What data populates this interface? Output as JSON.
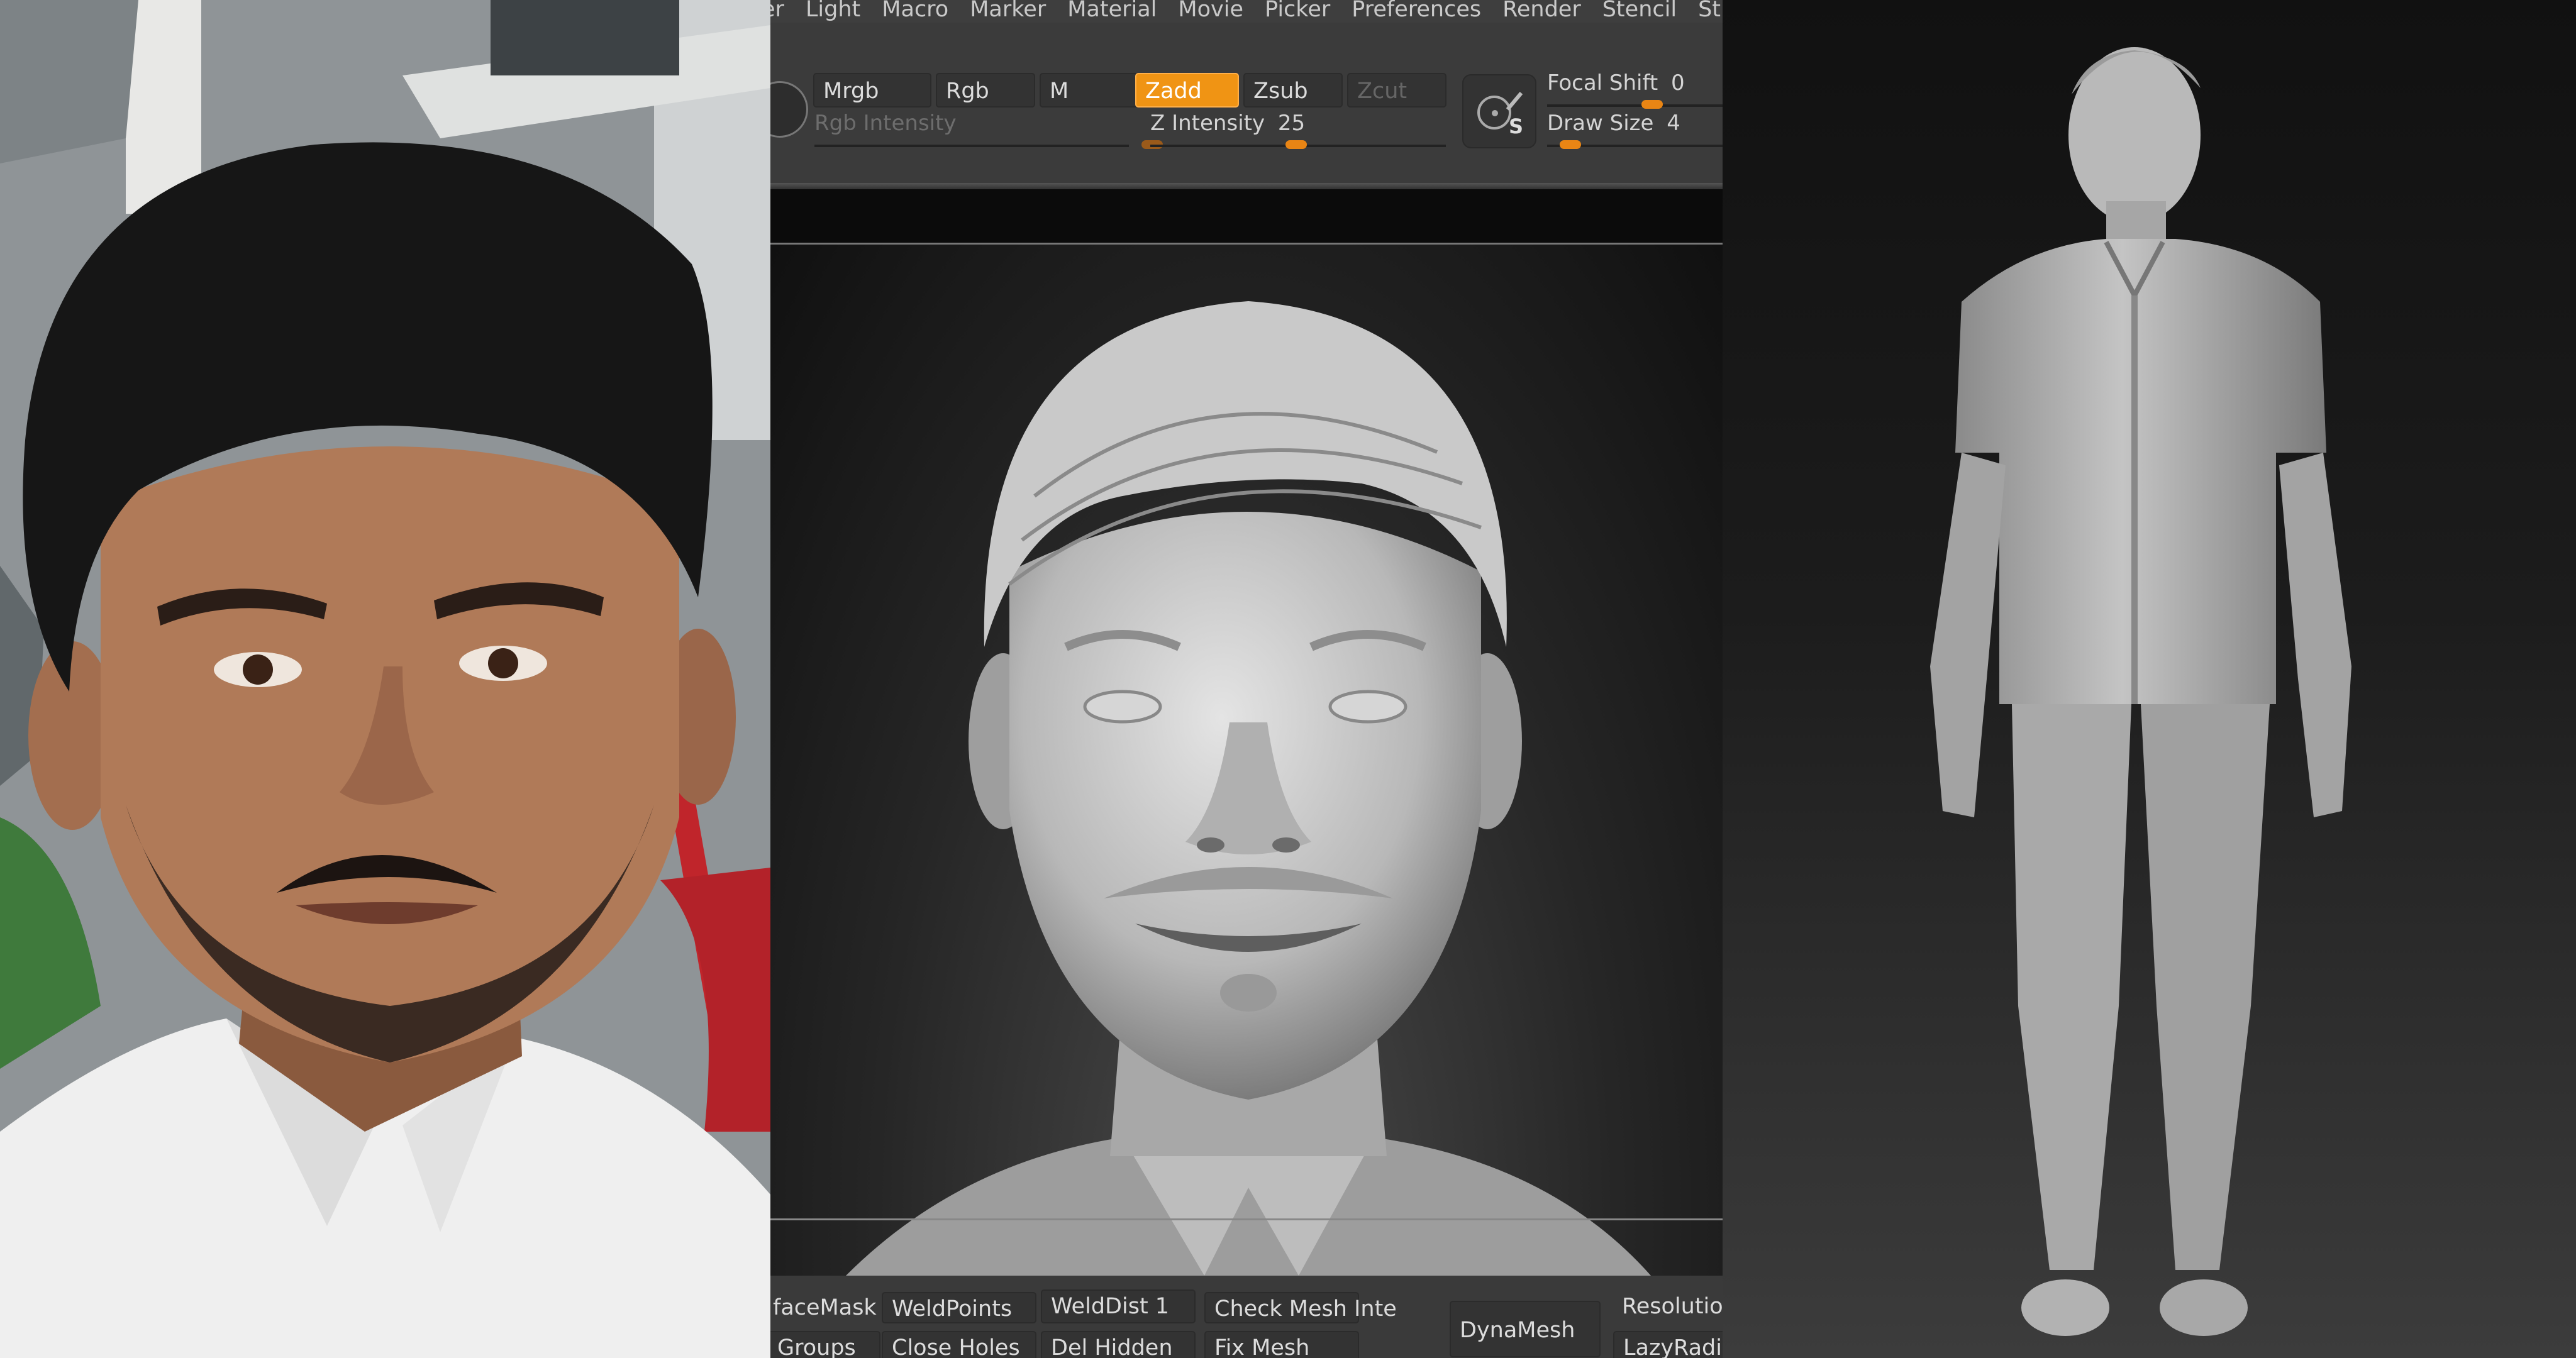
{
  "menu": {
    "items": [
      "er",
      "Light",
      "Macro",
      "Marker",
      "Material",
      "Movie",
      "Picker",
      "Preferences",
      "Render",
      "Stencil",
      "Stroke"
    ]
  },
  "toolbar": {
    "mrgb": "Mrgb",
    "rgb": "Rgb",
    "m": "M",
    "zadd": "Zadd",
    "zsub": "Zsub",
    "zcut": "Zcut",
    "rgb_intensity_label": "Rgb Intensity",
    "z_intensity_label": "Z Intensity",
    "z_intensity_value": "25",
    "focal_shift_label": "Focal Shift",
    "focal_shift_value": "0",
    "draw_size_label": "Draw Size",
    "draw_size_value": "4",
    "brush_icon_letter": "S"
  },
  "bottom": {
    "row1": [
      "faceMask",
      "WeldPoints",
      "WeldDist 1",
      "Check Mesh Inte"
    ],
    "row2": [
      "Groups",
      "Close Holes",
      "Del Hidden",
      "Fix Mesh"
    ],
    "dynamesh": "DynaMesh",
    "resolution": "Resolution",
    "lazyradius": "LazyRadius"
  },
  "colors": {
    "accent": "#f09414",
    "menu_bg": "#3e3e3e",
    "panel_bg": "#3b3b3b"
  },
  "icons": [
    "brush-icon",
    "radial-menu-icon"
  ]
}
